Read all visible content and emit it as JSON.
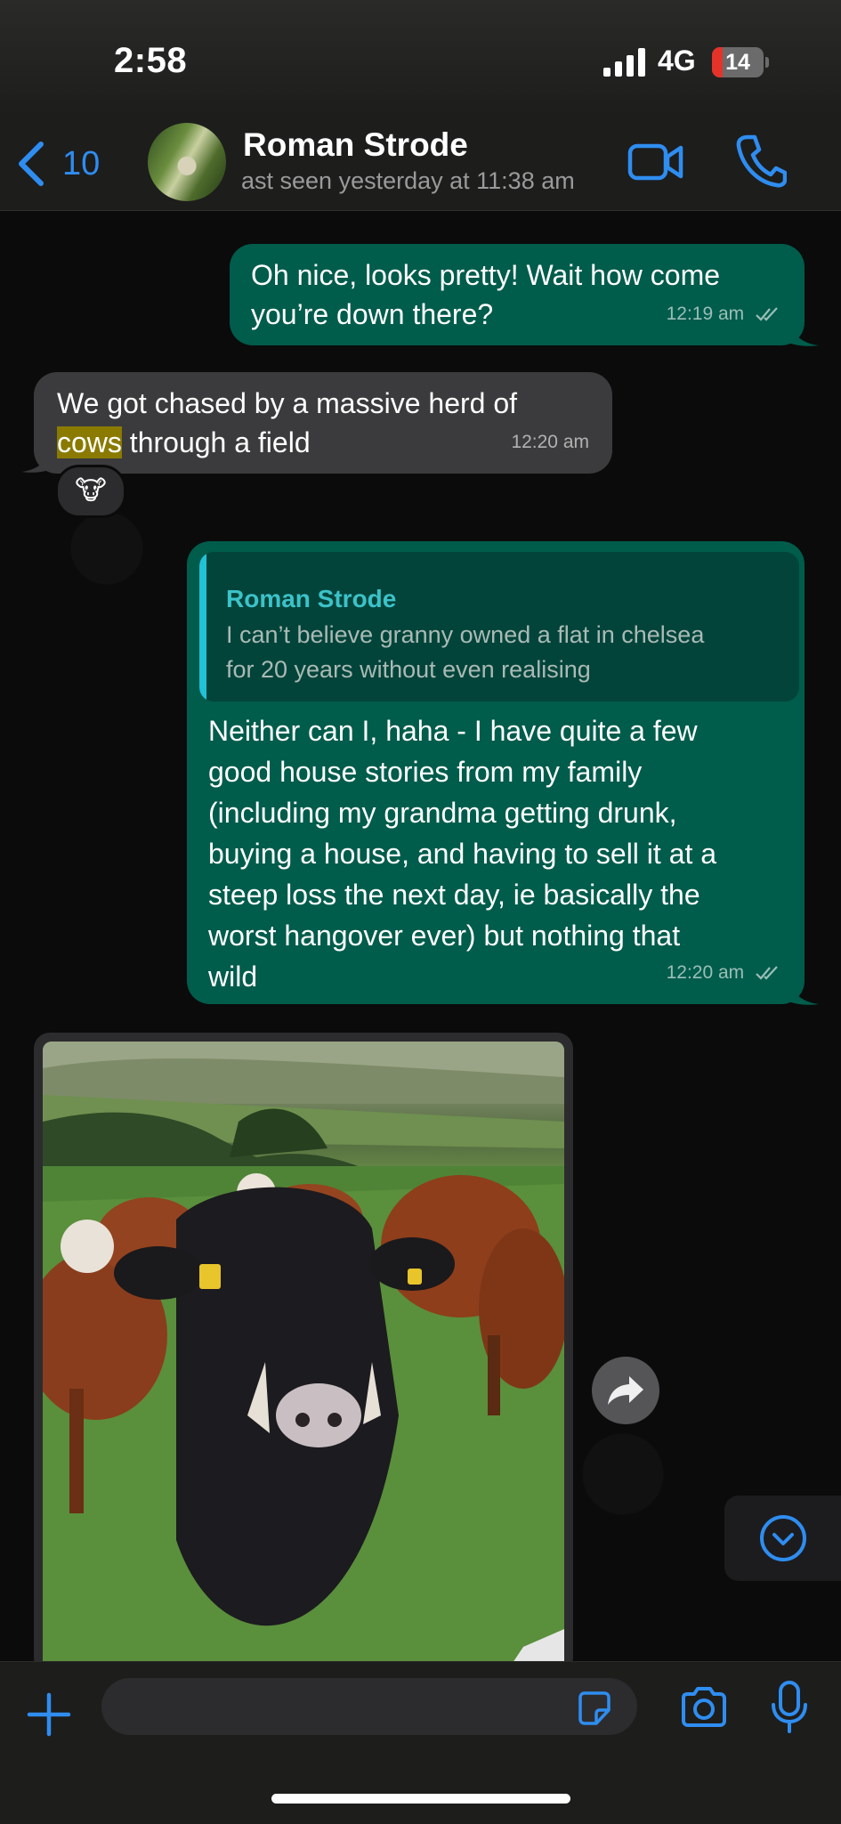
{
  "status_bar": {
    "time": "2:58",
    "network": "4G",
    "battery": "14"
  },
  "header": {
    "back_count": "10",
    "contact_name": "Roman Strode",
    "status": "ast seen yesterday at 11:38 am"
  },
  "messages": [
    {
      "direction": "outgoing",
      "text_line1": "Oh nice, looks pretty! Wait how come",
      "text_line2": "you’re down there?",
      "time": "12:19 am"
    },
    {
      "direction": "incoming",
      "text_line1": "We got chased by a massive herd of",
      "highlight": "cows",
      "text_line2_rest": " through a field",
      "time": "12:20 am",
      "reaction": "🐮"
    },
    {
      "direction": "outgoing",
      "quote": {
        "author": "Roman Strode",
        "line1": "I can’t believe granny owned a flat in chelsea",
        "line2": "for 20 years without even realising"
      },
      "lines": [
        "Neither can I, haha - I have quite a few",
        "good house stories from my family",
        "(including my grandma getting drunk,",
        "buying a house, and having to sell it at a",
        "steep loss the next day, ie basically the",
        "worst hangover ever) but nothing that",
        "wild"
      ],
      "time": "12:20 am"
    },
    {
      "direction": "incoming",
      "type": "image",
      "description_icon": "photo-cows-in-field"
    }
  ],
  "input": {
    "placeholder": ""
  },
  "icons": [
    "back-chevron-icon",
    "video-call-icon",
    "phone-icon",
    "forward-icon",
    "scroll-down-icon",
    "plus-icon",
    "sticker-icon",
    "camera-icon",
    "microphone-icon",
    "double-check-icon"
  ],
  "colors": {
    "accent": "#2f8df0",
    "outgoing_bubble": "#005c4b",
    "incoming_bubble": "#3b3b3d"
  }
}
